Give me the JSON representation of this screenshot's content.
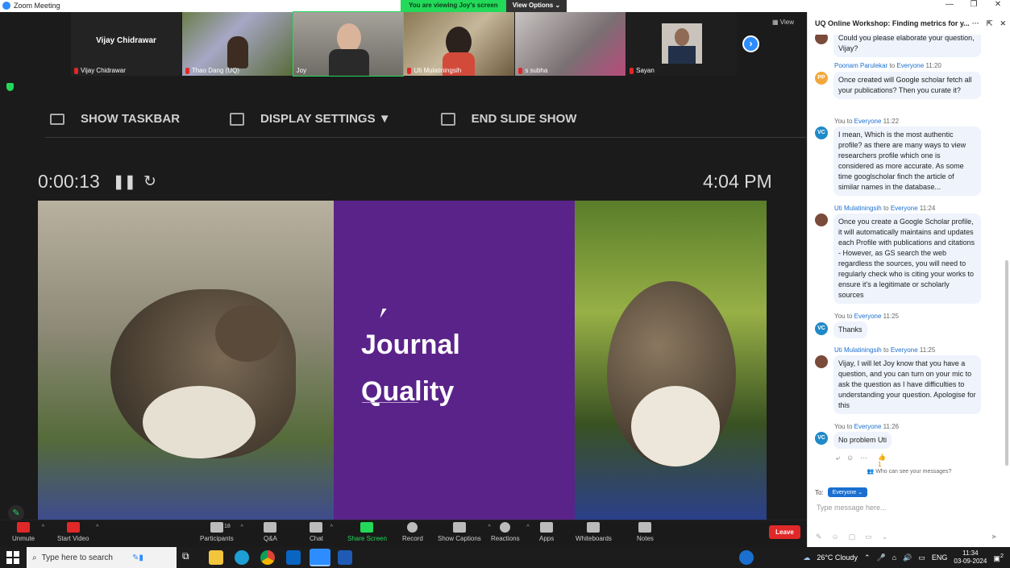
{
  "titlebar": {
    "app_name": "Zoom Meeting",
    "viewing_banner": "You are viewing Joy's screen",
    "view_options": "View Options",
    "controls": [
      "minimize-icon",
      "restore-icon",
      "close-icon"
    ]
  },
  "thumbnails": [
    {
      "name": "Vijay Chidrawar",
      "display_name": "Vijay Chidrawar",
      "muted": true,
      "video": false
    },
    {
      "name": "Thao Dang (UQ)",
      "muted": true,
      "video": true
    },
    {
      "name": "Joy",
      "muted": false,
      "video": true
    },
    {
      "name": "Uti Mulatiningsih",
      "muted": true,
      "video": true
    },
    {
      "name": "s subha",
      "muted": true,
      "video": true
    },
    {
      "name": "Sayan",
      "muted": true,
      "video": true
    }
  ],
  "view_label": "View",
  "slideshow": {
    "show_taskbar": "SHOW TASKBAR",
    "display_settings": "DISPLAY SETTINGS ▼",
    "end_slide_show": "END SLIDE SHOW",
    "timer": "0:00:13",
    "clock": "4:04 PM",
    "slide_title": "Journal\nQuality"
  },
  "toolbar": {
    "unmute": "Unmute",
    "start_video": "Start Video",
    "participants": "Participants",
    "participants_count": "18",
    "qa": "Q&A",
    "chat": "Chat",
    "share_screen": "Share Screen",
    "record": "Record",
    "show_captions": "Show Captions",
    "reactions": "Reactions",
    "apps": "Apps",
    "whiteboards": "Whiteboards",
    "notes": "Notes",
    "leave": "Leave"
  },
  "chat": {
    "title": "UQ Online Workshop: Finding metrics for y...",
    "messages": [
      {
        "text": "Could you please elaborate your question, Vijay?"
      },
      {
        "from": "Poonam Parulekar",
        "to": "Everyone",
        "time": "11:20",
        "avatar": "PP",
        "avatar_color": "#f2a93b",
        "text": "Once created will Google scholar fetch all your publications? Then you curate it?"
      },
      {
        "from": "You",
        "to": "Everyone",
        "time": "11:22",
        "avatar": "VC",
        "avatar_color": "#1f8ac8",
        "text": "I mean, Which is the most authentic profile? as there are many ways to view researchers profile which one is considered as more accurate. As some time googlscholar finch the article of similar names in the database..."
      },
      {
        "from": "Uti Mulatiningsih",
        "to": "Everyone",
        "time": "11:24",
        "avatar": "",
        "avatar_color": "#7a4a3a",
        "text": "Once you create a Google Scholar profile, it will automatically maintains and updates each Profile with publications and citations - However, as GS search the web regardless the sources, you will need to regularly check who is citing your works to ensure it's a legitimate or scholarly sources"
      },
      {
        "from": "You",
        "to": "Everyone",
        "time": "11:25",
        "avatar": "VC",
        "avatar_color": "#1f8ac8",
        "text": "Thanks"
      },
      {
        "from": "Uti Mulatiningsih",
        "to": "Everyone",
        "time": "11:25",
        "avatar": "",
        "avatar_color": "#7a4a3a",
        "text": "Vijay, I will let Joy know that you have a question, and you can turn on your mic to ask the question as I have difficulties to understanding your question. Apologise for this"
      },
      {
        "from": "You",
        "to": "Everyone",
        "time": "11:26",
        "avatar": "VC",
        "avatar_color": "#1f8ac8",
        "text": "No problem Uti"
      }
    ],
    "to_word": "to",
    "reaction_count": "👍1",
    "who_can_see": "Who can see your messages?",
    "to_label": "To:",
    "to_value": "Everyone ⌄",
    "input_placeholder": "Type message here..."
  },
  "taskbar": {
    "search_placeholder": "Type here to search",
    "weather": "26°C  Cloudy",
    "lang": "ENG",
    "time": "11:34",
    "date": "03-09-2024",
    "notif": "2"
  }
}
